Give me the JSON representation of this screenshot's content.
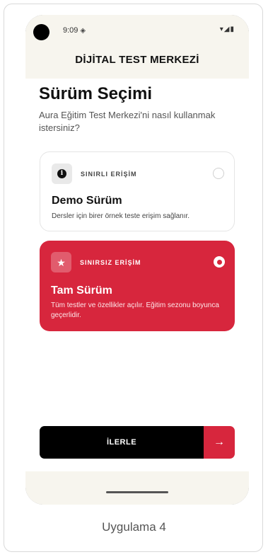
{
  "status_bar": {
    "time": "9:09",
    "time_icon": "data-saver-icon",
    "right_icons": "wifi-signal-battery-icons"
  },
  "header": {
    "title": "DİJİTAL TEST MERKEZİ"
  },
  "main": {
    "title": "Sürüm Seçimi",
    "subtitle": "Aura Eğitim Test Merkezi'ni nasıl kullanmak istersiniz?"
  },
  "options": [
    {
      "tag": "SINIRLI ERİŞİM",
      "name": "Demo Sürüm",
      "description": "Dersler için birer örnek teste erişim sağlanır.",
      "icon": "info-icon",
      "selected": false
    },
    {
      "tag": "SINIRSIZ ERİŞİM",
      "name": "Tam Sürüm",
      "description": "Tüm testler ve özellikler açılır. Eğitim sezonu boyunca geçerlidir.",
      "icon": "star-icon",
      "selected": true
    }
  ],
  "proceed_button": {
    "label": "İLERLE",
    "icon": "arrow-right-icon"
  },
  "caption": "Uygulama 4",
  "colors": {
    "accent": "#d7263d",
    "header_bg": "#f7f5ee",
    "button_bg": "#000000"
  }
}
